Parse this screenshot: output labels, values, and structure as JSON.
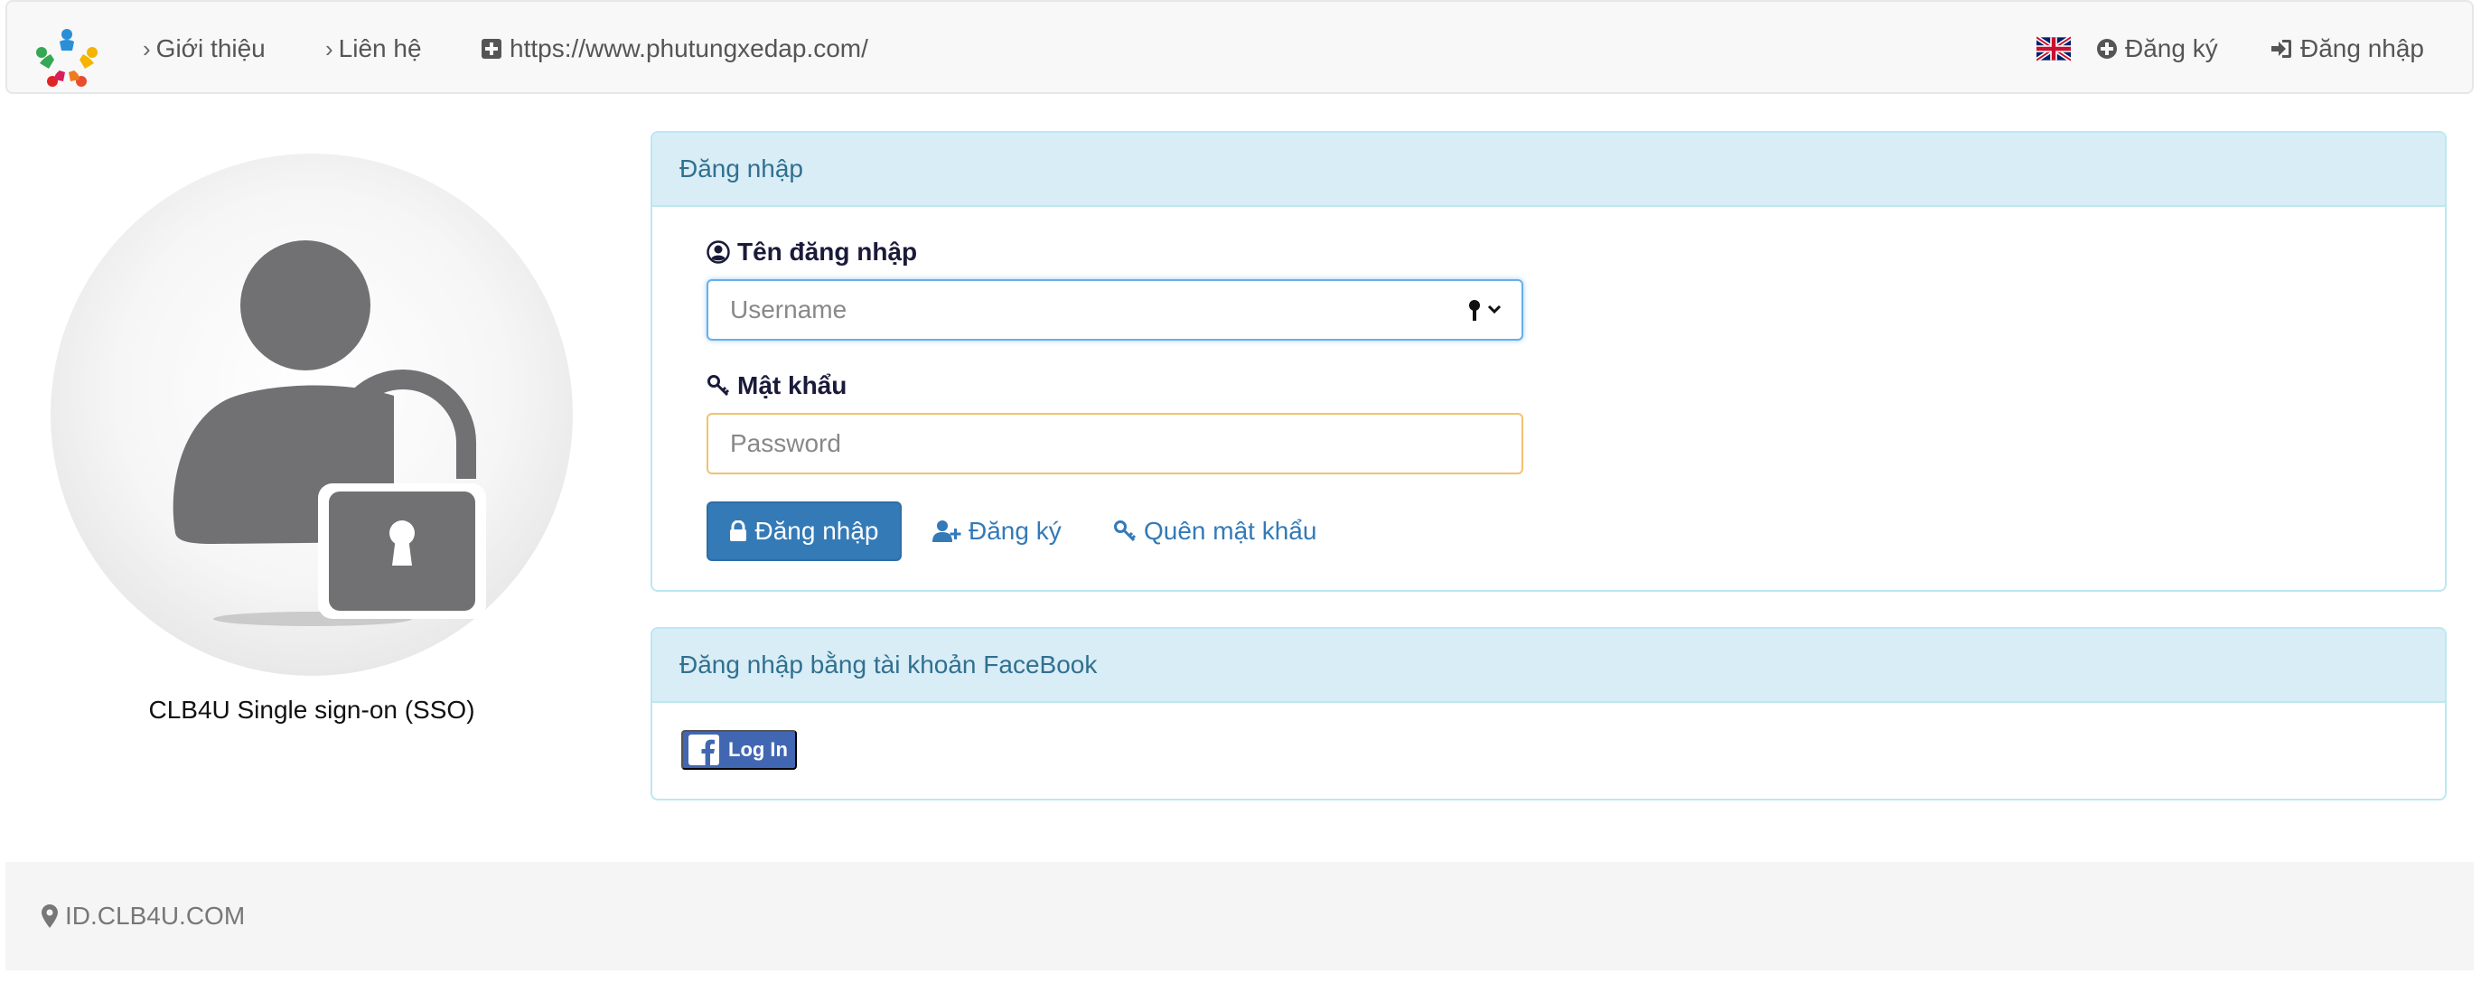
{
  "navbar": {
    "links": [
      {
        "label": "Giới thiệu"
      },
      {
        "label": "Liên hệ"
      },
      {
        "label": "https://www.phutungxedap.com/"
      }
    ],
    "register_label": "Đăng ký",
    "login_label": "Đăng nhập"
  },
  "left": {
    "caption": "CLB4U Single sign-on (SSO)"
  },
  "login_panel": {
    "heading": "Đăng nhập",
    "username_label": "Tên đăng nhập",
    "username_placeholder": "Username",
    "password_label": "Mật khẩu",
    "password_placeholder": "Password",
    "submit_label": "Đăng nhập",
    "register_label": "Đăng ký",
    "forgot_label": "Quên mật khẩu"
  },
  "facebook_panel": {
    "heading": "Đăng nhập bằng tài khoản FaceBook",
    "button_label": "Log In"
  },
  "footer": {
    "text": "ID.CLB4U.COM"
  },
  "colors": {
    "primary": "#337ab7",
    "panel_heading_bg": "#d9edf7",
    "panel_border": "#bce8f1",
    "facebook": "#4267b2"
  }
}
